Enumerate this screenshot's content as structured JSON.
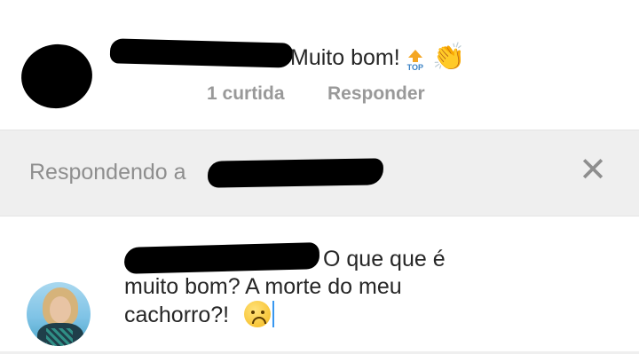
{
  "comment": {
    "text": "Muito bom!",
    "top_icon_label": "TOP",
    "likes": "1 curtida",
    "reply_label": "Responder"
  },
  "reply_bar": {
    "label": "Respondendo a",
    "close_symbol": "✕"
  },
  "composer": {
    "line1": "O que que é",
    "line2": "muito bom? A morte do meu",
    "line3": "cachorro?!"
  },
  "colors": {
    "text": "#262626",
    "muted": "#999999",
    "bar_bg": "#efefef",
    "caret": "#3897f0"
  }
}
